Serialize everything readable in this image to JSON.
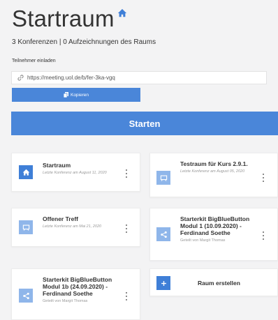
{
  "header": {
    "title": "Startraum",
    "subtitle": "3 Konferenzen | 0 Aufzeichnungen des Raums"
  },
  "invite": {
    "label": "Teilnehmer einladen",
    "url": "https://meeting.uol.de/b/fer-3ka-vgq",
    "copy_label": "Kopieren"
  },
  "start_label": "Starten",
  "colors": {
    "accent": "#4a86d9",
    "icon_active": "#3f7fd7",
    "icon_inactive": "#8fb6ea",
    "background": "#f3f3f4"
  },
  "rooms": [
    {
      "name": "Startraum",
      "meta": "Letzte Konferenz am August 11, 2020",
      "icon": "home-icon",
      "active": true
    },
    {
      "name": "Testraum für Kurs 2.9.1.",
      "meta": "Letzte Konferenz am August 05, 2020",
      "icon": "chalkboard-icon",
      "active": false
    },
    {
      "name": "Offener Treff",
      "meta": "Letzte Konferenz am Mai 21, 2020",
      "icon": "chalkboard-icon",
      "active": false
    },
    {
      "name": "Starterkit BigBlueButton Modul 1 (10.09.2020) - Ferdinand Soethe",
      "meta": "Geteilt von Margit Thomas",
      "icon": "share-icon",
      "active": false
    },
    {
      "name": "Starterkit BigBlueButton Modul 1b (24.09.2020) - Ferdinand Soethe",
      "meta": "Geteilt von Margit Thomas",
      "icon": "share-icon",
      "active": false
    }
  ],
  "create_room_label": "Raum erstellen"
}
